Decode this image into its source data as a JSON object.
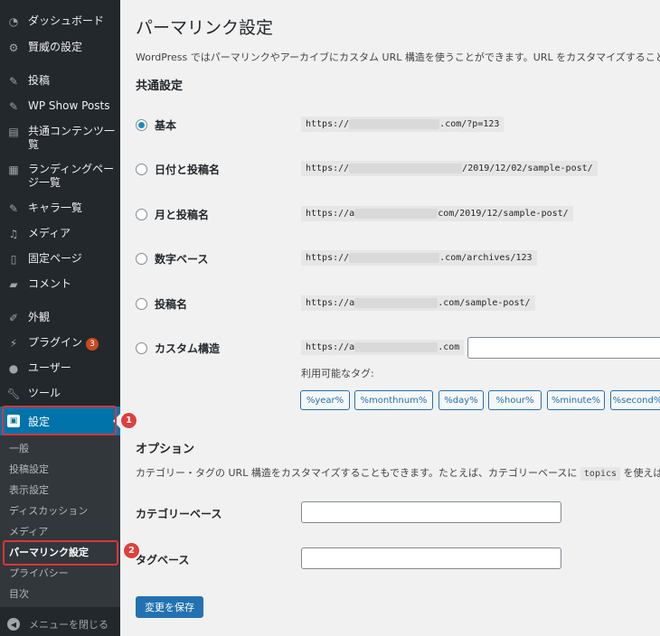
{
  "sidebar": {
    "items": [
      {
        "label": "ダッシュボード",
        "icon": "dashboard-icon"
      },
      {
        "label": "賢威の設定",
        "icon": "gear-icon"
      },
      {
        "label": "投稿",
        "icon": "pin-icon"
      },
      {
        "label": "WP Show Posts",
        "icon": "pin-icon"
      },
      {
        "label": "共通コンテンツ一覧",
        "icon": "code-file-icon"
      },
      {
        "label": "ランディングページ一覧",
        "icon": "layout-icon"
      },
      {
        "label": "キャラ一覧",
        "icon": "pin-icon"
      },
      {
        "label": "メディア",
        "icon": "media-icon"
      },
      {
        "label": "固定ページ",
        "icon": "page-icon"
      },
      {
        "label": "コメント",
        "icon": "comment-icon"
      },
      {
        "label": "外観",
        "icon": "brush-icon"
      },
      {
        "label": "プラグイン",
        "icon": "plugin-icon",
        "badge": "3"
      },
      {
        "label": "ユーザー",
        "icon": "user-icon"
      },
      {
        "label": "ツール",
        "icon": "wrench-icon"
      }
    ],
    "active": {
      "label": "設定",
      "icon": "settings-icon"
    },
    "submenu": [
      "一般",
      "投稿設定",
      "表示設定",
      "ディスカッション",
      "メディア",
      "パーマリンク設定",
      "プライバシー",
      "目次"
    ],
    "collapse_label": "メニューを閉じる"
  },
  "annotations": {
    "step1": "1",
    "step2": "2"
  },
  "main": {
    "title": "パーマリンク設定",
    "intro": "WordPress ではパーマリンクやアーカイブにカスタム URL 構造を使うことができます。URL をカスタマイズすることで、",
    "common_heading": "共通設定",
    "options": [
      {
        "label": "基本",
        "prefix": "https://",
        "suffix": ".com/?p=123",
        "checked": true
      },
      {
        "label": "日付と投稿名",
        "prefix": "https://",
        "suffix": "/2019/12/02/sample-post/",
        "checked": false
      },
      {
        "label": "月と投稿名",
        "prefix": "https://a",
        "suffix": "com/2019/12/sample-post/",
        "checked": false
      },
      {
        "label": "数字ベース",
        "prefix": "https://",
        "suffix": ".com/archives/123",
        "checked": false
      },
      {
        "label": "投稿名",
        "prefix": "https://a",
        "suffix": ".com/sample-post/",
        "checked": false
      },
      {
        "label": "カスタム構造",
        "prefix": "https://a",
        "suffix": ".com",
        "checked": false
      }
    ],
    "available_tags_label": "利用可能なタグ:",
    "tags": [
      "%year%",
      "%monthnum%",
      "%day%",
      "%hour%",
      "%minute%",
      "%second%"
    ],
    "optional_heading": "オプション",
    "optional_desc_before": "カテゴリー・タグの URL 構造をカスタマイズすることもできます。たとえば、カテゴリーベースに",
    "optional_code": "topics",
    "optional_desc_after": "を使えば、",
    "category_base_label": "カテゴリーベース",
    "tag_base_label": "タグベース",
    "save_label": "変更を保存"
  },
  "colors": {
    "sidebar_bg": "#23282d",
    "active_bg": "#0073aa",
    "accent": "#2271b1",
    "annotation": "#e03e3e"
  }
}
